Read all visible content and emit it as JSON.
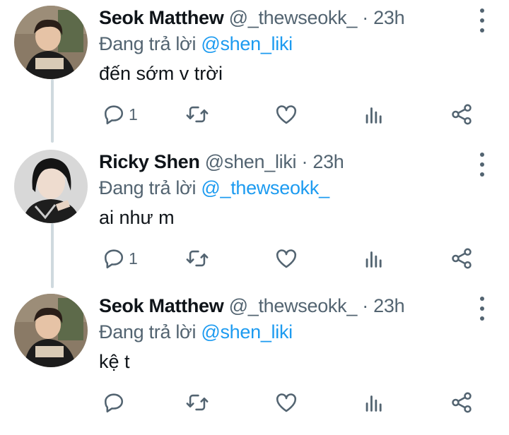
{
  "tweets": [
    {
      "name": "Seok Matthew",
      "handle": "@_thewseokk_",
      "separator": "·",
      "time": "23h",
      "replying_prefix": "Đang trả lời",
      "replying_to": "@shen_liki",
      "text": "đến sớm v trời",
      "reply_count": "1",
      "avatar_color": "#6b5a48"
    },
    {
      "name": "Ricky Shen",
      "handle": "@shen_liki",
      "separator": "·",
      "time": "23h",
      "replying_prefix": "Đang trả lời",
      "replying_to": "@_thewseokk_",
      "text": "ai như m",
      "reply_count": "1",
      "avatar_color": "#2a2a2a"
    },
    {
      "name": "Seok Matthew",
      "handle": "@_thewseokk_",
      "separator": "·",
      "time": "23h",
      "replying_prefix": "Đang trả lời",
      "replying_to": "@shen_liki",
      "text": "kệ t",
      "reply_count": "",
      "avatar_color": "#6b5a48"
    }
  ],
  "colors": {
    "link": "#1d9bf0",
    "secondary": "#536471",
    "thread_line": "#cfd9de"
  },
  "icons": [
    "reply-icon",
    "retweet-icon",
    "like-icon",
    "analytics-icon",
    "share-icon",
    "more-icon"
  ]
}
